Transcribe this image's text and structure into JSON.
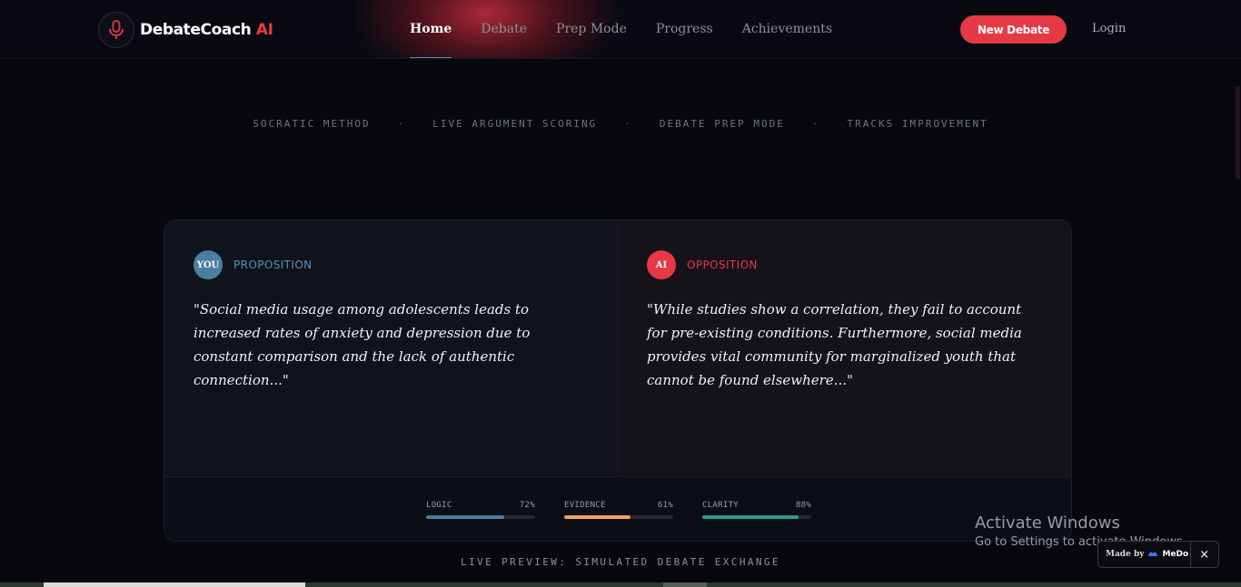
{
  "nav": {
    "brand": {
      "name": "DebateCoach",
      "accent": "AI",
      "icon": "microphone-icon"
    },
    "links": [
      {
        "label": "Home",
        "active": true
      },
      {
        "label": "Debate",
        "active": false
      },
      {
        "label": "Prep Mode",
        "active": false
      },
      {
        "label": "Progress",
        "active": false
      },
      {
        "label": "Achievements",
        "active": false
      }
    ],
    "new_debate_label": "New Debate",
    "login_label": "Login"
  },
  "features": [
    "SOCRATIC METHOD",
    "LIVE ARGUMENT SCORING",
    "DEBATE PREP MODE",
    "TRACKS IMPROVEMENT"
  ],
  "feature_separator": "·",
  "debate": {
    "proposition": {
      "avatar": "YOU",
      "role": "PROPOSITION",
      "quote": "\"Social media usage among adolescents leads to increased rates of anxiety and depression due to constant comparison and the lack of authentic connection...\""
    },
    "opposition": {
      "avatar": "AI",
      "role": "OPPOSITION",
      "quote": "\"While studies show a correlation, they fail to account for pre-existing conditions. Furthermore, social media provides vital community for marginalized youth that cannot be found elsewhere...\""
    },
    "scores": [
      {
        "label": "LOGIC",
        "value": 72,
        "display": "72%",
        "color": "#4a7fa3"
      },
      {
        "label": "EVIDENCE",
        "value": 61,
        "display": "61%",
        "color": "#f4a261"
      },
      {
        "label": "CLARITY",
        "value": 88,
        "display": "88%",
        "color": "#2a9d8f"
      }
    ]
  },
  "caption": "LIVE PREVIEW: SIMULATED DEBATE EXCHANGE",
  "windows": {
    "title": "Activate Windows",
    "subtitle": "Go to Settings to activate Windows."
  },
  "made_by": {
    "label": "Made by",
    "brand": "MeDo",
    "close": "×"
  },
  "colors": {
    "accent": "#e63946",
    "proposition": "#4a7fa3",
    "background": "#07080e"
  }
}
